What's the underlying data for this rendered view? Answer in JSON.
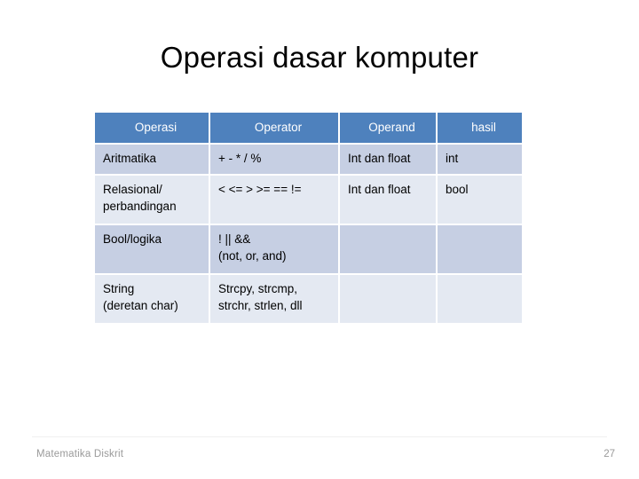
{
  "slide": {
    "title": "Operasi dasar komputer"
  },
  "table": {
    "headers": [
      "Operasi",
      "Operator",
      "Operand",
      "hasil"
    ],
    "rows": [
      {
        "operasi": [
          "Aritmatika"
        ],
        "operator": [
          "+ - * / %"
        ],
        "operand": [
          "Int dan float"
        ],
        "hasil": [
          "int"
        ]
      },
      {
        "operasi": [
          "Relasional/",
          "perbandingan"
        ],
        "operator": [
          "< <= > >= == !="
        ],
        "operand": [
          "Int dan float"
        ],
        "hasil": [
          "bool"
        ]
      },
      {
        "operasi": [
          "Bool/logika"
        ],
        "operator": [
          "!  ||  &&",
          "(not, or, and)"
        ],
        "operand": [
          ""
        ],
        "hasil": [
          ""
        ]
      },
      {
        "operasi": [
          "String",
          "(deretan char)"
        ],
        "operator": [
          "Strcpy, strcmp,",
          "strchr, strlen, dll"
        ],
        "operand": [
          ""
        ],
        "hasil": [
          ""
        ]
      }
    ]
  },
  "footer": {
    "left_label": "Matematika Diskrit",
    "page_number": "27"
  },
  "colors": {
    "header_blue": "#4E81BD",
    "row_dark": "#C6CFE3",
    "row_light": "#E4E9F2",
    "footer_text": "#9A9A9A",
    "body_text": "#000000"
  }
}
